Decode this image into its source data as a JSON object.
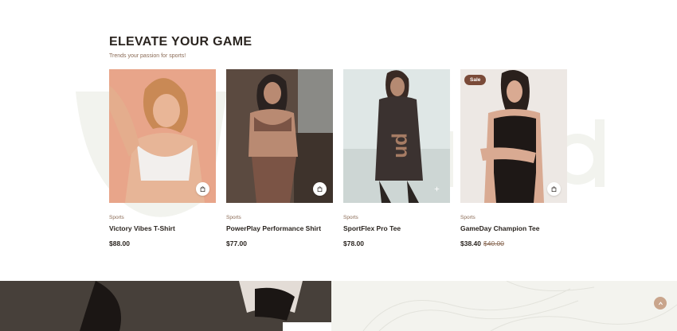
{
  "section": {
    "title": "ELEVATE YOUR GAME",
    "subtitle": "Trends your passion for sports!"
  },
  "products": [
    {
      "category": "Sports",
      "name": "Victory Vibes T-Shirt",
      "price": "$88.00",
      "old_price": "",
      "badge": "",
      "image_bg": "#e8a58a"
    },
    {
      "category": "Sports",
      "name": "PowerPlay Performance Shirt",
      "price": "$77.00",
      "old_price": "",
      "badge": "",
      "image_bg": "#6a5448"
    },
    {
      "category": "Sports",
      "name": "SportFlex Pro Tee",
      "price": "$78.00",
      "old_price": "",
      "badge": "",
      "image_bg": "#dfe7e6"
    },
    {
      "category": "Sports",
      "name": "GameDay Champion Tee",
      "price": "$38.40",
      "old_price": "$40.00",
      "badge": "Sale",
      "image_bg": "#ede8e4"
    }
  ],
  "icons": {
    "cart": "shopping-bag-icon",
    "scroll_top": "chevron-up-icon"
  },
  "colors": {
    "accent": "#7a4a38",
    "text": "#2b2520",
    "muted": "#8a6a55",
    "banner_dark": "#3f3630",
    "banner_light": "#f3f3ee"
  }
}
